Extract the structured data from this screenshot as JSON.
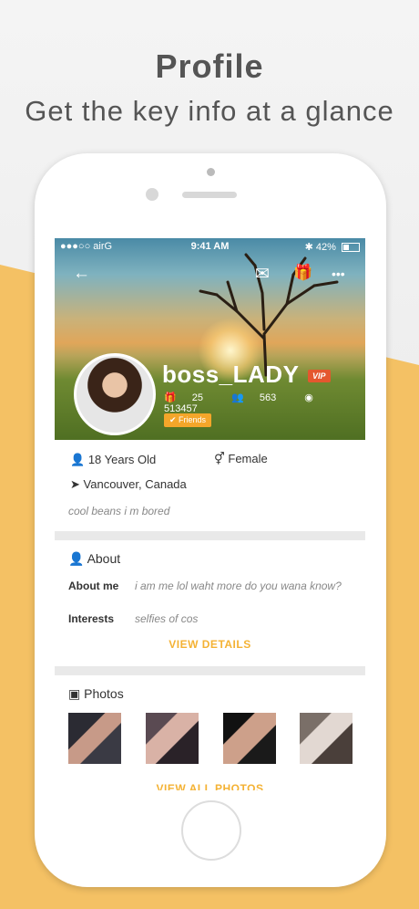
{
  "hero": {
    "title": "Profile",
    "subtitle": "Get the key info at a glance"
  },
  "status": {
    "carrier": "●●●○○ airG",
    "time": "9:41 AM",
    "battery": "42%"
  },
  "nav": {
    "back_icon": "←",
    "message_icon": "✉",
    "gift_icon": "🎁",
    "more_icon": "•••"
  },
  "profile": {
    "username": "boss_LADY",
    "vip": "VIP",
    "gifts": "25",
    "friends_count": "563",
    "views": "513457",
    "friends_badge": "✔ Friends",
    "age": "18 Years Old",
    "gender": "Female",
    "location": "Vancouver, Canada",
    "bio": "cool beans i m bored"
  },
  "about": {
    "title": "About",
    "about_me_label": "About me",
    "about_me_value": "i am me lol waht more do you wana know?",
    "interests_label": "Interests",
    "interests_value": "selfies of cos",
    "view_details": "VIEW DETAILS"
  },
  "photos": {
    "title": "Photos",
    "view_all": "VIEW ALL PHOTOS"
  },
  "colors": {
    "accent": "#f4b234",
    "vip": "#e4572e",
    "background_yellow": "#f4c164"
  }
}
